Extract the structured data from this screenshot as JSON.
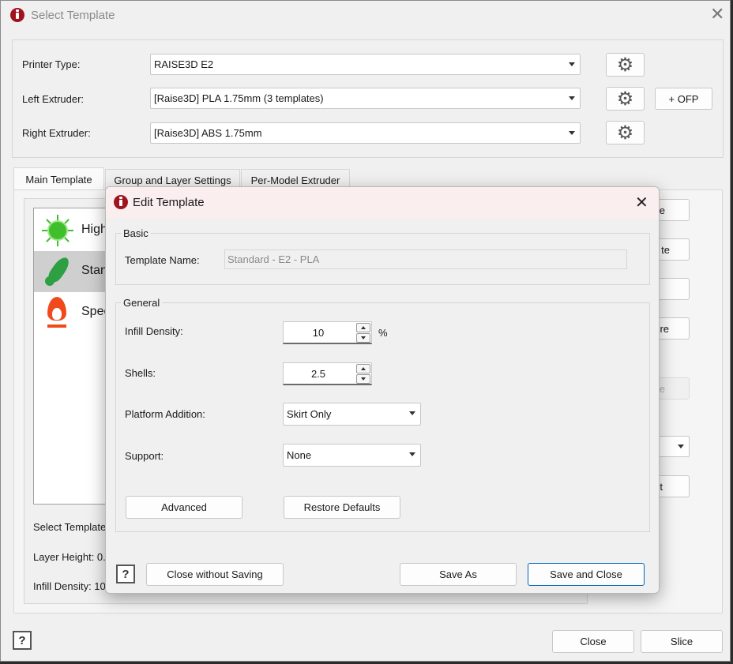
{
  "main_window": {
    "title": "Select Template",
    "printer_type_label": "Printer Type:",
    "printer_type_value": "RAISE3D E2",
    "left_extruder_label": "Left Extruder:",
    "left_extruder_value": "[Raise3D] PLA 1.75mm (3 templates)",
    "right_extruder_label": "Right Extruder:",
    "right_extruder_value": "[Raise3D] ABS 1.75mm",
    "ofp_button": "+ OFP",
    "tabs": [
      {
        "label": "Main Template",
        "active": true
      },
      {
        "label": "Group and Layer Settings",
        "active": false
      },
      {
        "label": "Per-Model Extruder",
        "active": false
      }
    ],
    "templates": [
      {
        "label": "High",
        "icon": "virus-icon",
        "selected": false
      },
      {
        "label": "Stand",
        "icon": "rocket-icon",
        "selected": true
      },
      {
        "label": "Speed",
        "icon": "fire-icon",
        "selected": false
      }
    ],
    "select_template_label": "Select Template",
    "layer_height_label": "Layer Height: 0.",
    "infill_density_label": "Infill Density: 10",
    "right_buttons_partial": [
      "e",
      "te",
      "",
      "re",
      "e",
      "",
      "t"
    ],
    "help_label": "?",
    "close_button": "Close",
    "slice_button": "Slice"
  },
  "edit_dialog": {
    "title": "Edit Template",
    "basic_legend": "Basic",
    "template_name_label": "Template Name:",
    "template_name_value": "Standard - E2 - PLA",
    "general_legend": "General",
    "infill_density_label": "Infill Density:",
    "infill_density_value": "10",
    "infill_unit": "%",
    "shells_label": "Shells:",
    "shells_value": "2.5",
    "platform_addition_label": "Platform Addition:",
    "platform_addition_value": "Skirt Only",
    "support_label": "Support:",
    "support_value": "None",
    "advanced_button": "Advanced",
    "restore_defaults_button": "Restore Defaults",
    "help_label": "?",
    "close_without_saving_button": "Close without Saving",
    "save_as_button": "Save As",
    "save_and_close_button": "Save and Close"
  },
  "colors": {
    "window_bg": "#f0f0f0",
    "dialog_title_bg": "#fbeeee",
    "brand_red": "#a0141e",
    "selected_row": "#cfcfcf",
    "primary_border": "#0067c0"
  }
}
